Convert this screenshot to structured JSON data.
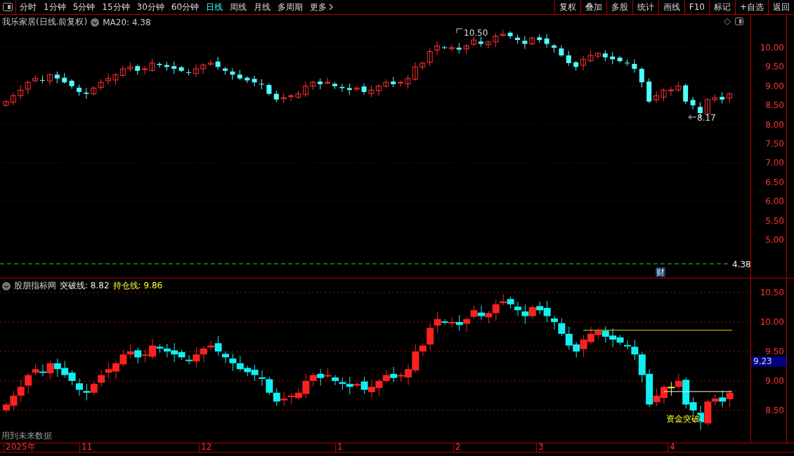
{
  "toolbar": {
    "periods": [
      {
        "label": "分时",
        "selected": false
      },
      {
        "label": "1分钟",
        "selected": false
      },
      {
        "label": "5分钟",
        "selected": false
      },
      {
        "label": "15分钟",
        "selected": false
      },
      {
        "label": "30分钟",
        "selected": false
      },
      {
        "label": "60分钟",
        "selected": false
      },
      {
        "label": "日线",
        "selected": true
      },
      {
        "label": "周线",
        "selected": false
      },
      {
        "label": "月线",
        "selected": false
      },
      {
        "label": "多周期",
        "selected": false
      },
      {
        "label": "更多",
        "selected": false
      }
    ],
    "actions": [
      "复权",
      "叠加",
      "多股",
      "统计",
      "画线",
      "F10",
      "标记",
      "+自选",
      "返回"
    ]
  },
  "main_chart": {
    "title": "我乐家居(日线.前复权)",
    "ma_label": "MA20: 4.38",
    "axis_labels": [
      "10.00",
      "9.50",
      "9.00",
      "8.50",
      "8.00",
      "7.50",
      "7.00",
      "6.50",
      "6.00",
      "5.50",
      "5.00"
    ],
    "high_label": "10.50",
    "low_label": "8.17",
    "ma_value_label": "4.38",
    "finance_badge": "财"
  },
  "indicator_panel": {
    "name": "股朋指标网",
    "breakout_label": "突破线: 8.82",
    "holding_label": "持仓线: 9.86",
    "axis_labels": [
      "10.50",
      "10.00",
      "9.50",
      "9.00",
      "8.50"
    ],
    "current_value": "9.23",
    "signal_label": "资金突破",
    "warning": "用到未来数据"
  },
  "time_axis": [
    "2025年",
    "11",
    "12",
    "1",
    "2",
    "3",
    "4"
  ]
}
